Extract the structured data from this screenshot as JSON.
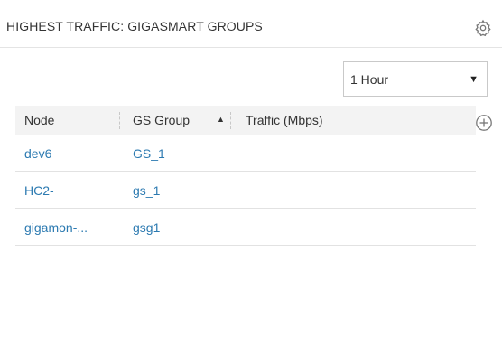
{
  "widget": {
    "title": "HIGHEST TRAFFIC: GIGASMART GROUPS",
    "settings_icon": "gear-icon",
    "add_icon": "plus-circle-icon"
  },
  "time_range": {
    "selected": "1 Hour",
    "arrow": "▼"
  },
  "table": {
    "columns": [
      "Node",
      "GS Group",
      "Traffic (Mbps)"
    ],
    "sort_indicator": "▲",
    "rows": [
      {
        "node": "dev6",
        "gs_group": "GS_1",
        "traffic": ""
      },
      {
        "node": "HC2-",
        "gs_group": "gs_1",
        "traffic": ""
      },
      {
        "node": "gigamon-...",
        "gs_group": "gsg1",
        "traffic": ""
      }
    ]
  },
  "colors": {
    "link": "#2c7ab1",
    "header_bg": "#f3f3f3",
    "icon": "#777777"
  }
}
